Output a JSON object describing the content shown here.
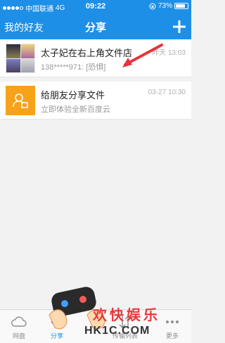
{
  "status_bar": {
    "carrier": "中国联通",
    "network": "4G",
    "time": "09:22",
    "battery": "73%"
  },
  "nav": {
    "left_link": "我的好友",
    "title": "分享",
    "add_icon": "plus-icon"
  },
  "conversations": [
    {
      "name": "太子妃在右上角文件店",
      "preview": "138*****971: [恐惧]",
      "time": "昨天 13:03",
      "avatar": "photo-collage"
    },
    {
      "name": "给朋友分享文件",
      "preview": "立即体验全新百度云",
      "time": "03-27 10:30",
      "avatar": "share-user-icon"
    }
  ],
  "tabs": [
    {
      "label": "网盘",
      "icon": "cloud-icon"
    },
    {
      "label": "分享",
      "icon": "share-icon",
      "active": true
    },
    {
      "label": "传输列表",
      "icon": "transfer-icon"
    },
    {
      "label": "更多",
      "icon": "more-icon"
    }
  ],
  "watermark": {
    "line1": "欢快娱乐",
    "line2": "HK1C.COM"
  },
  "colors": {
    "brand": "#1e8fe7",
    "accent_orange": "#f7a21b",
    "arrow": "#e8333a"
  }
}
